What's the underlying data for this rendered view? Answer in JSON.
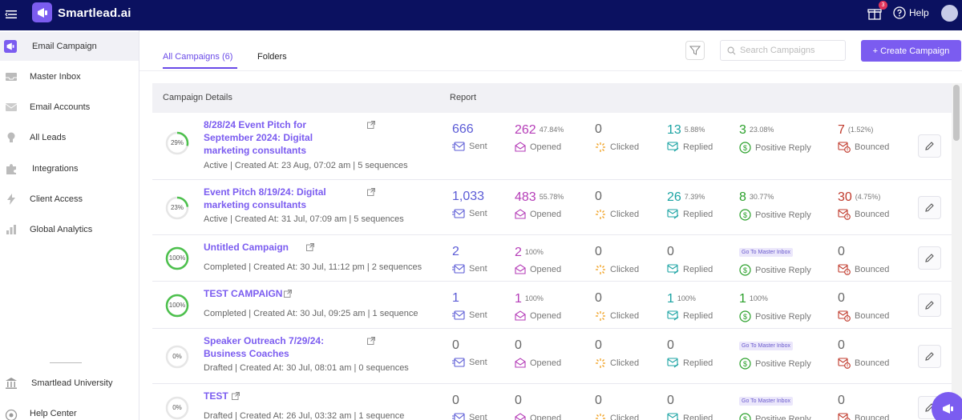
{
  "app": {
    "name": "Smartlead.ai",
    "help_label": "Help",
    "notifications_count": "3"
  },
  "sidebar": {
    "items": [
      {
        "label": "Email Campaign",
        "icon": "megaphone-icon",
        "active": true
      },
      {
        "label": "Master Inbox",
        "icon": "inbox-icon"
      },
      {
        "label": "Email Accounts",
        "icon": "envelope-icon"
      },
      {
        "label": "All Leads",
        "icon": "bulb-icon"
      },
      {
        "label": "Integrations",
        "icon": "puzzle-icon"
      },
      {
        "label": "Client Access",
        "icon": "bolt-icon"
      },
      {
        "label": "Global Analytics",
        "icon": "bar-chart-icon"
      }
    ],
    "bottom_items": [
      {
        "label": "Smartlead University",
        "icon": "university-icon"
      },
      {
        "label": "Help Center",
        "icon": "help-center-icon"
      }
    ]
  },
  "tabs": {
    "all": "All Campaigns (6)",
    "folders": "Folders"
  },
  "search": {
    "placeholder": "Search Campaigns"
  },
  "create_button": "+ Create Campaign",
  "table": {
    "headers": {
      "details": "Campaign Details",
      "report": "Report"
    },
    "metric_labels": {
      "sent": "Sent",
      "opened": "Opened",
      "clicked": "Clicked",
      "replied": "Replied",
      "positive": "Positive Reply",
      "bounced": "Bounced"
    },
    "go_to_inbox": "Go To Master Inbox",
    "rows": [
      {
        "progress": "29%",
        "progress_value": 0.29,
        "name_line1": "8/28/24 Event Pitch for",
        "name_line2": "September 2024: Digital",
        "name_line3": "marketing consultants",
        "meta": "Active | Created At: 23 Aug, 07:02 am | 5 sequences",
        "sent": "666",
        "opened": "262",
        "opened_pct": "47.84%",
        "clicked": "0",
        "replied": "13",
        "replied_pct": "5.88%",
        "positive": "3",
        "positive_pct": "23.08%",
        "bounced": "7",
        "bounced_pct": "(1.52%)"
      },
      {
        "progress": "23%",
        "progress_value": 0.23,
        "name_line1": "Event Pitch 8/19/24: Digital",
        "name_line2": "marketing consultants",
        "meta": "Active | Created At: 31 Jul, 07:09 am | 5 sequences",
        "sent": "1,033",
        "opened": "483",
        "opened_pct": "55.78%",
        "clicked": "0",
        "replied": "26",
        "replied_pct": "7.39%",
        "positive": "8",
        "positive_pct": "30.77%",
        "bounced": "30",
        "bounced_pct": "(4.75%)"
      },
      {
        "progress": "100%",
        "progress_value": 1.0,
        "name_line1": "Untitled Campaign",
        "meta": "Completed | Created At: 30 Jul, 11:12 pm | 2 sequences",
        "sent": "2",
        "opened": "2",
        "opened_pct": "100%",
        "clicked": "0",
        "replied": "0",
        "positive_tag": true,
        "bounced": "0"
      },
      {
        "progress": "100%",
        "progress_value": 1.0,
        "name_line1": "TEST CAMPAIGN",
        "meta": "Completed | Created At: 30 Jul, 09:25 am | 1 sequence",
        "sent": "1",
        "opened": "1",
        "opened_pct": "100%",
        "clicked": "0",
        "replied": "1",
        "replied_pct": "100%",
        "positive": "1",
        "positive_pct": "100%",
        "bounced": "0"
      },
      {
        "progress": "0%",
        "progress_value": 0,
        "name_line1": "Speaker Outreach 7/29/24:",
        "name_line2": "Business Coaches",
        "meta": "Drafted | Created At: 30 Jul, 08:01 am | 0 sequences",
        "sent": "0",
        "opened": "0",
        "clicked": "0",
        "replied": "0",
        "positive_tag": true,
        "bounced": "0"
      },
      {
        "progress": "0%",
        "progress_value": 0,
        "name_line1": "TEST",
        "meta": "Drafted | Created At: 26 Jul, 03:32 am | 1 sequence",
        "sent": "0",
        "opened": "0",
        "clicked": "0",
        "replied": "0",
        "positive_tag": true,
        "bounced": "0"
      }
    ]
  },
  "colors": {
    "brand": "#7b5cf0",
    "topbar": "#0b1160",
    "sent": "#5b5bd6",
    "opened": "#b53db8",
    "replied": "#1aa3a3",
    "positive": "#2aa02a",
    "bounced": "#c0392b",
    "ring_progress": "#4cc04c"
  }
}
